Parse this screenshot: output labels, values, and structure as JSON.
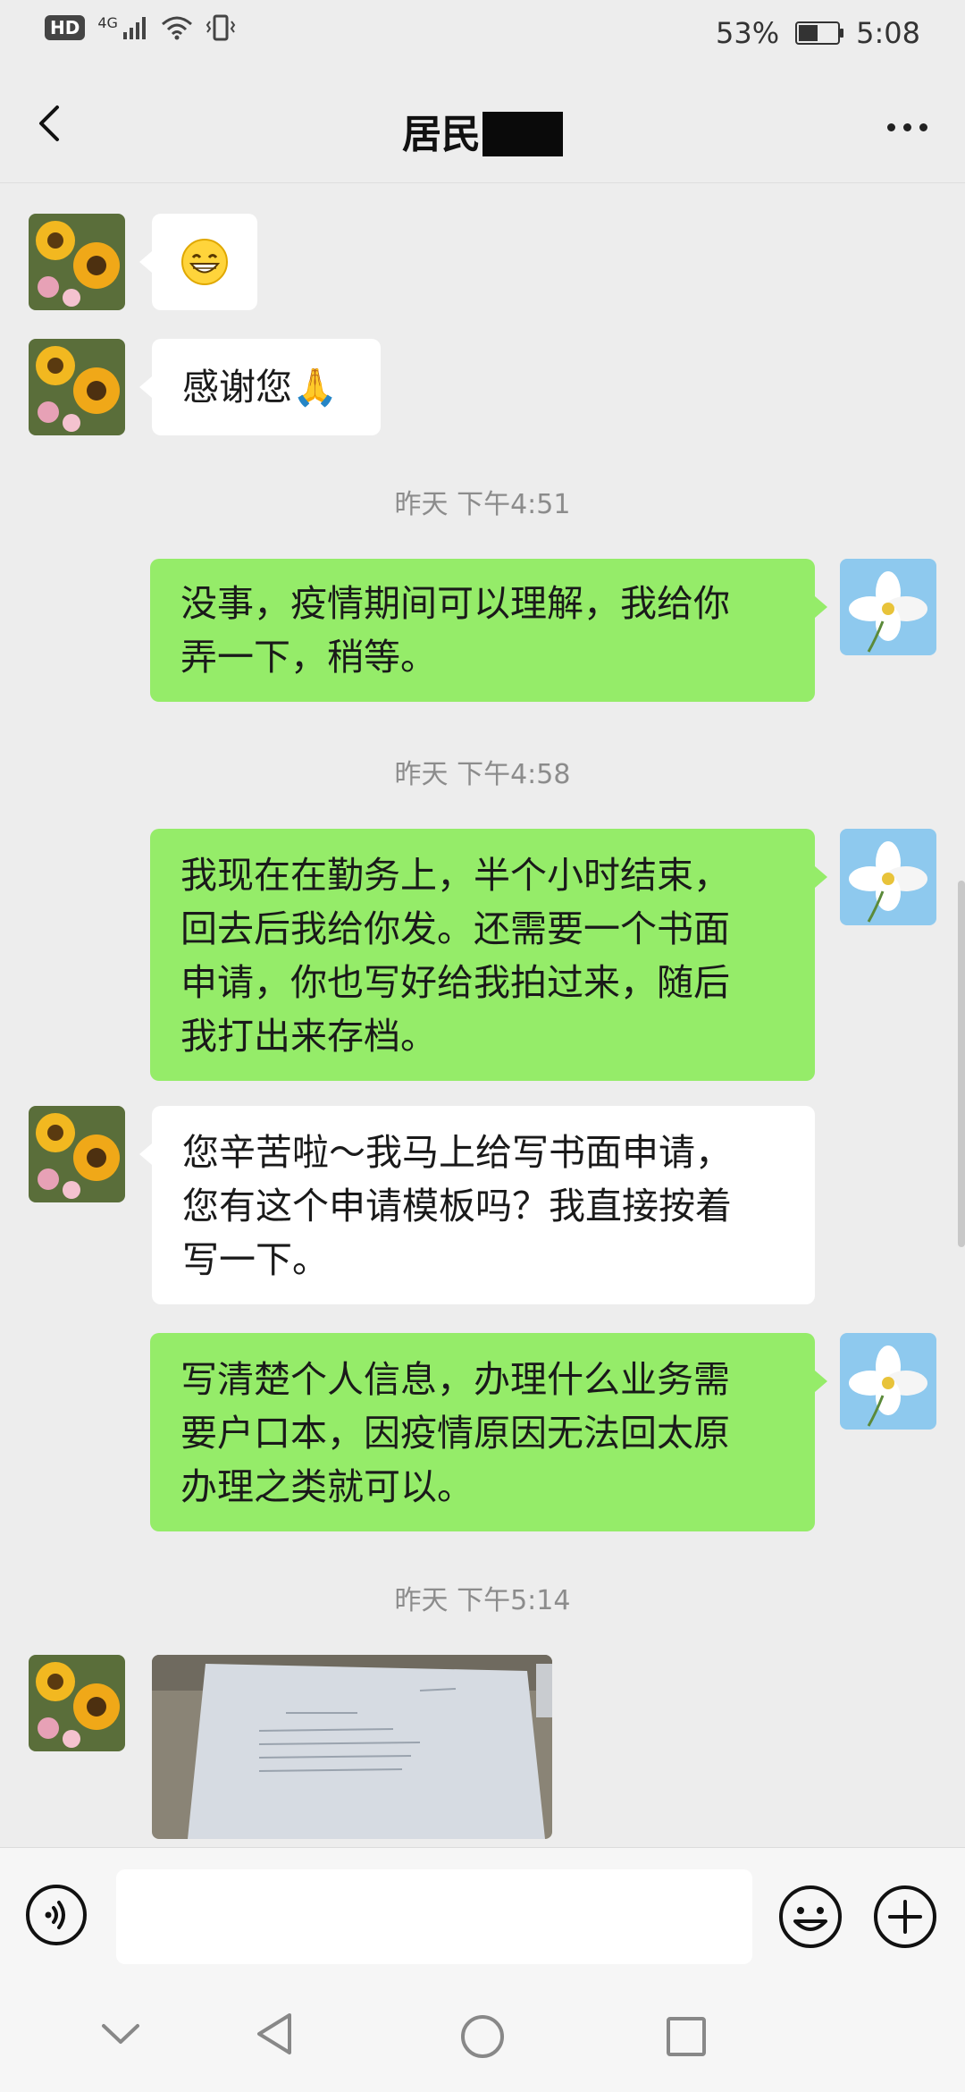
{
  "status_bar": {
    "hd": "HD",
    "network": "4G",
    "battery_percent": "53%",
    "battery_level": 0.53,
    "time": "5:08"
  },
  "header": {
    "title": "居民"
  },
  "messages": [
    {
      "side": "left",
      "type": "emoji",
      "text": "😁"
    },
    {
      "side": "left",
      "type": "text",
      "text": "感谢您🙏"
    },
    {
      "type": "time",
      "text": "昨天 下午4:51"
    },
    {
      "side": "right",
      "type": "text",
      "lines": [
        "没事，疫情期间可以理解，我给你",
        "弄一下，稍等。"
      ]
    },
    {
      "type": "time",
      "text": "昨天 下午4:58"
    },
    {
      "side": "right",
      "type": "text",
      "lines": [
        "我现在在勤务上，半个小时结束，",
        "回去后我给你发。还需要一个书面",
        "申请，你也写好给我拍过来，随后",
        "我打出来存档。"
      ]
    },
    {
      "side": "left",
      "type": "text",
      "lines": [
        "您辛苦啦～我马上给写书面申请，",
        "您有这个申请模板吗？我直接按着",
        "写一下。"
      ]
    },
    {
      "side": "right",
      "type": "text",
      "lines": [
        "写清楚个人信息，办理什么业务需",
        "要户口本，因疫情原因无法回太原",
        "办理之类就可以。"
      ]
    },
    {
      "type": "time",
      "text": "昨天 下午5:14"
    },
    {
      "side": "left",
      "type": "image"
    }
  ],
  "input_bar": {
    "voice_icon": "voice-icon",
    "emoji_icon": "smiley-icon",
    "plus_icon": "plus-icon"
  },
  "system_nav": {
    "icons": [
      "chevron-down-icon",
      "back-triangle-icon",
      "home-circle-icon",
      "recents-square-icon"
    ]
  },
  "colors": {
    "sent_bubble": "#95ec69",
    "received_bubble": "#ffffff",
    "background": "#ededed"
  }
}
